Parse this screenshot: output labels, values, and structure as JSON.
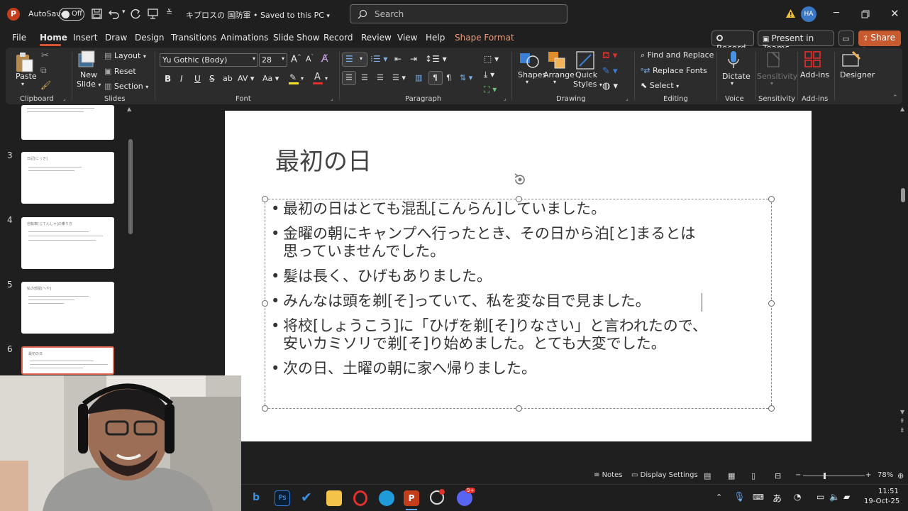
{
  "titlebar": {
    "app_logo": "P",
    "autosave_label": "AutoSave",
    "autosave_state": "Off",
    "doc_title": "キプロスの 国防軍 • Saved to this PC",
    "search_placeholder": "Search",
    "avatar_initials": "HA"
  },
  "menu": {
    "items": [
      "File",
      "Home",
      "Insert",
      "Draw",
      "Design",
      "Transitions",
      "Animations",
      "Slide Show",
      "Record",
      "Review",
      "View",
      "Help",
      "Shape Format"
    ],
    "record_button": "Record",
    "present_button": "Present in Teams",
    "share_button": "Share"
  },
  "ribbon": {
    "clipboard": {
      "paste": "Paste",
      "group": "Clipboard"
    },
    "slides": {
      "new_slide_1": "New",
      "new_slide_2": "Slide",
      "layout": "Layout",
      "reset": "Reset",
      "section": "Section",
      "group": "Slides"
    },
    "font": {
      "family": "Yu Gothic (Body)",
      "size": "28",
      "group": "Font"
    },
    "paragraph": {
      "group": "Paragraph"
    },
    "drawing": {
      "shapes": "Shapes",
      "arrange": "Arrange",
      "quick_styles_1": "Quick",
      "quick_styles_2": "Styles",
      "group": "Drawing"
    },
    "editing": {
      "find_replace": "Find and Replace",
      "replace_fonts": "Replace Fonts",
      "select": "Select",
      "group": "Editing"
    },
    "voice": {
      "dictate": "Dictate",
      "group": "Voice"
    },
    "sensitivity": {
      "label": "Sensitivity",
      "group": "Sensitivity"
    },
    "addins": {
      "label": "Add-ins",
      "group": "Add-ins"
    },
    "designer": {
      "label": "Designer"
    }
  },
  "thumbnails": [
    {
      "number": "",
      "title": ""
    },
    {
      "number": "3",
      "title": "日記[にっき]"
    },
    {
      "number": "4",
      "title": "自転車[じてんしゃ]の乗り方"
    },
    {
      "number": "5",
      "title": "私の部屋[へや]"
    },
    {
      "number": "6",
      "title": "最初の日"
    }
  ],
  "slide": {
    "title": "最初の日",
    "bullets": [
      "最初の日はとても混乱[こんらん]していました。",
      "金曜の朝にキャンプへ行ったとき、その日から泊[と]まるとは",
      "思っていませんでした。",
      "髪は長く、ひげもありました。",
      "みんなは頭を剃[そ]っていて、私を変な目で見ました。",
      "将校[しょうこう]に「ひげを剃[そ]りなさい」と言われたので、",
      "安いカミソリで剃[そ]り始めました。とても大変でした。",
      "次の日、土曜の朝に家へ帰りました。"
    ]
  },
  "statusbar": {
    "notes": "Notes",
    "display_settings": "Display Settings",
    "zoom": "78%"
  },
  "taskbar": {
    "time": "11:51",
    "date": "19-Oct-25",
    "ime": "あ",
    "badge": "9+"
  }
}
